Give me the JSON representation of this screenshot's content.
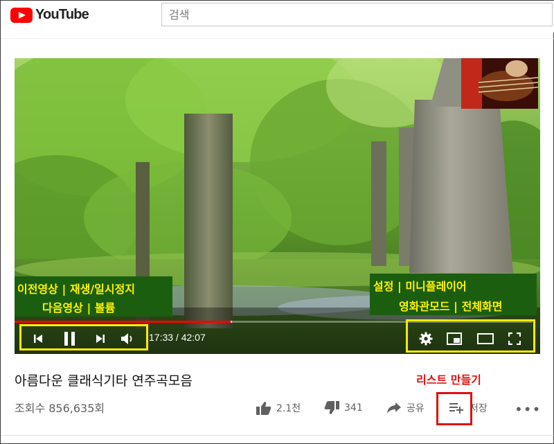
{
  "header": {
    "logo_text": "YouTube",
    "search_placeholder": "검색"
  },
  "player": {
    "current_time": "17:33",
    "separator": " / ",
    "duration": "42:07",
    "progress_fraction": 0.4168,
    "buffer_fraction": 0.42,
    "controls": {
      "prev": "previous-icon",
      "play_pause": "pause-icon",
      "next": "next-icon",
      "volume": "volume-icon",
      "settings": "gear-icon",
      "miniplayer": "miniplayer-icon",
      "theater": "theater-icon",
      "fullscreen": "fullscreen-icon"
    }
  },
  "annotations": {
    "left_line1": "이전영상 | 재생/일시정지",
    "left_line2": "다음영상 | 볼륨",
    "right_line1": "설정 | 미니플레이어",
    "right_line2": "영화관모드 | 전체화면",
    "list_note": "리스트 만들기"
  },
  "video_info": {
    "title": "아름다운 클래식기타 연주곡모음",
    "views": "조회수 856,635회"
  },
  "actions": {
    "like_count": "2.1천",
    "dislike_count": "341",
    "share_label": "공유",
    "save_label": "저장",
    "more_label": "•••"
  },
  "colors": {
    "brand_red": "#ff0000",
    "annotation_yellow": "#ffeb00",
    "annotation_bg": "#1b5e10",
    "note_red": "#e01010"
  }
}
